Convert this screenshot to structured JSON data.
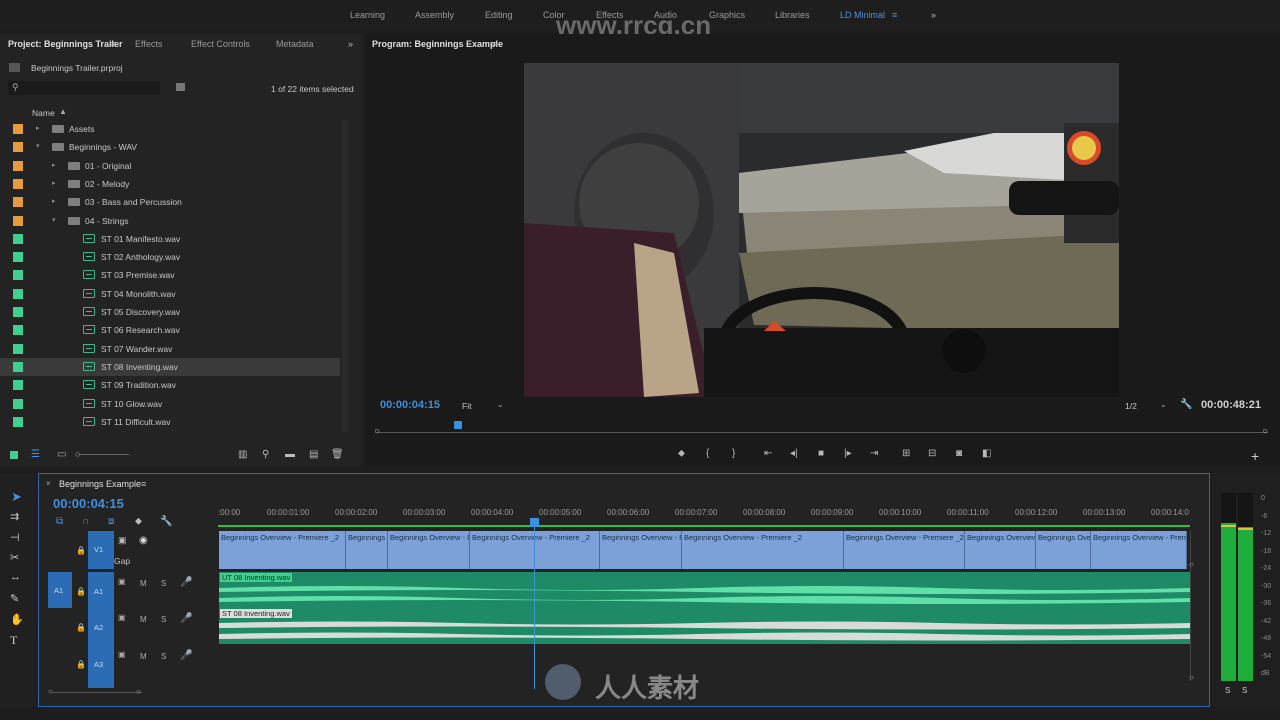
{
  "workspaces": [
    "Learning",
    "Assembly",
    "Editing",
    "Color",
    "Effects",
    "Audio",
    "Graphics",
    "Libraries",
    "LD Minimal"
  ],
  "active_workspace": "LD Minimal",
  "watermark_url": "www.rrcg.cn",
  "project": {
    "tabs": [
      "Project: Beginnings Trailer",
      "Effects",
      "Effect Controls",
      "Metadata"
    ],
    "file": "Beginnings Trailer.prproj",
    "search_placeholder": "",
    "selection": "1 of 22 items selected",
    "column": "Name",
    "items": [
      {
        "label": "Assets",
        "color": "#e89b3c",
        "type": "folder",
        "depth": 0
      },
      {
        "label": "Beginnings - WAV",
        "color": "#e89b3c",
        "type": "folder",
        "depth": 0
      },
      {
        "label": "01 - Original",
        "color": "#e89b3c",
        "type": "folder",
        "depth": 1
      },
      {
        "label": "02 - Melody",
        "color": "#e89b3c",
        "type": "folder",
        "depth": 1
      },
      {
        "label": "03 - Bass and Percussion",
        "color": "#e89b3c",
        "type": "folder",
        "depth": 1
      },
      {
        "label": "04 - Strings",
        "color": "#e89b3c",
        "type": "folder",
        "depth": 1
      },
      {
        "label": "ST 01 Manifesto.wav",
        "color": "#3fcf8e",
        "type": "wav",
        "depth": 2
      },
      {
        "label": "ST 02 Anthology.wav",
        "color": "#3fcf8e",
        "type": "wav",
        "depth": 2
      },
      {
        "label": "ST 03 Premise.wav",
        "color": "#3fcf8e",
        "type": "wav",
        "depth": 2
      },
      {
        "label": "ST 04 Monolith.wav",
        "color": "#3fcf8e",
        "type": "wav",
        "depth": 2
      },
      {
        "label": "ST 05 Discovery.wav",
        "color": "#3fcf8e",
        "type": "wav",
        "depth": 2
      },
      {
        "label": "ST 06 Research.wav",
        "color": "#3fcf8e",
        "type": "wav",
        "depth": 2
      },
      {
        "label": "ST 07 Wander.wav",
        "color": "#3fcf8e",
        "type": "wav",
        "depth": 2
      },
      {
        "label": "ST 08 Inventing.wav",
        "color": "#3fcf8e",
        "type": "wav",
        "depth": 2
      },
      {
        "label": "ST 09 Tradition.wav",
        "color": "#3fcf8e",
        "type": "wav",
        "depth": 2
      },
      {
        "label": "ST 10 Glow.wav",
        "color": "#3fcf8e",
        "type": "wav",
        "depth": 2
      },
      {
        "label": "ST 11 Difficult.wav",
        "color": "#3fcf8e",
        "type": "wav",
        "depth": 2
      }
    ]
  },
  "program": {
    "title": "Program: Beginnings Example",
    "current_time": "00:00:04:15",
    "fit": "Fit",
    "resolution": "1/2",
    "duration": "00:00:48:21"
  },
  "timeline": {
    "title": "Beginnings Example",
    "current_time": "00:00:04:15",
    "ruler": [
      ":00:00",
      "00:00:01:00",
      "00:00:02:00",
      "00:00:03:00",
      "00:00:04:00",
      "00:00:05:00",
      "00:00:06:00",
      "00:00:07:00",
      "00:00:08:00",
      "00:00:09:00",
      "00:00:10:00",
      "00:00:11:00",
      "00:00:12:00",
      "00:00:13:00",
      "00:00:14:0"
    ],
    "tracks": {
      "v1": "V1",
      "gap": "Gap",
      "a1_src": "A1",
      "a1": "A1",
      "a2": "A2",
      "a3": "A3",
      "m": "M",
      "s": "S"
    },
    "video_clips": [
      "Beginnings Overview - Premiere _2",
      "Beginnings O",
      "Beginnings Overview - Pre",
      "Beginnings Overview - Premiere _2",
      "Beginnings Overview - Pr",
      "Beginnings Overview - Premiere _2",
      "Beginnings Overview - Premiere _2",
      "Beginnings Overview",
      "Beginnings Over",
      "Beginnings Overview - Premie"
    ],
    "audio_clip_1": "UT 08 Inventing.wav",
    "audio_clip_2": "ST 08 Inventing.wav"
  },
  "meter": {
    "labels": [
      "0",
      "-6",
      "-12",
      "-18",
      "-24",
      "-30",
      "-36",
      "-42",
      "-48",
      "-54",
      "dB"
    ],
    "solo": [
      "S",
      "S"
    ],
    "level_left": 0.84,
    "level_right": 0.82
  },
  "bottom_watermark": "人人素材"
}
